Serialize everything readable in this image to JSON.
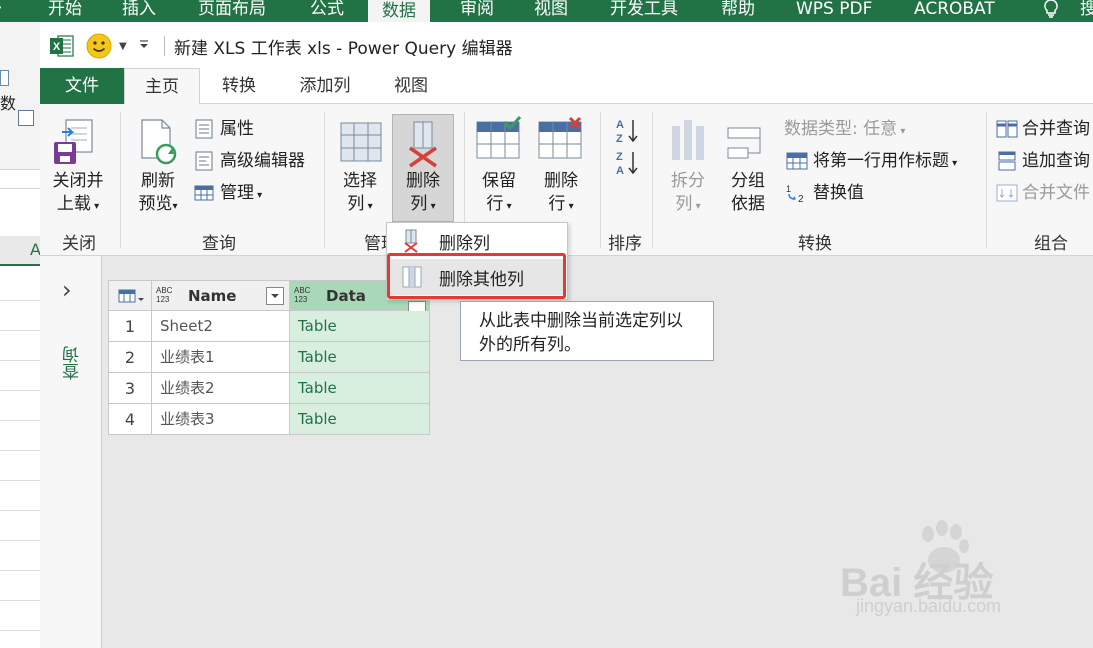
{
  "excel": {
    "tabs": [
      "开始",
      "插入",
      "页面布局",
      "公式",
      "数据",
      "审阅",
      "视图",
      "开发工具",
      "帮助",
      "WPS PDF",
      "ACROBAT",
      "搜"
    ],
    "active_tab": "数据",
    "left_fragments": [
      "数",
      "A"
    ]
  },
  "window": {
    "title": "新建 XLS 工作表 xls - Power Query 编辑器",
    "accent": "#217346"
  },
  "ribbon_tabs": [
    "文件",
    "主页",
    "转换",
    "添加列",
    "视图"
  ],
  "groups": {
    "close": {
      "label": "关闭",
      "close_load": [
        "关闭并",
        "上载"
      ]
    },
    "query": {
      "label": "查询",
      "refresh": [
        "刷新",
        "预览"
      ],
      "properties": "属性",
      "advanced_editor": "高级编辑器",
      "manage": "管理"
    },
    "manage_cols": {
      "label": "管理",
      "choose_cols": [
        "选择",
        "列"
      ],
      "remove_cols": [
        "删除",
        "列"
      ]
    },
    "reduce_rows": {
      "keep_rows": [
        "保留",
        "行"
      ],
      "remove_rows": [
        "删除",
        "行"
      ]
    },
    "sort": {
      "label": "排序"
    },
    "transform": {
      "label": "转换",
      "split_col": [
        "拆分",
        "列"
      ],
      "group_by": [
        "分组",
        "依据"
      ],
      "data_type": "数据类型: 任意",
      "use_first_row": "将第一行用作标题",
      "replace_values": "替换值"
    },
    "combine": {
      "label": "组合",
      "merge_queries": "合并查询",
      "append_queries": "追加查询",
      "combine_files": "合并文件"
    }
  },
  "dropdown": {
    "items": [
      "删除列",
      "删除其他列"
    ],
    "highlight_color": "#e53935"
  },
  "tooltip": {
    "lines": [
      "从此表中删除当前选定列以",
      "外的所有列。"
    ]
  },
  "query_pane": {
    "expand_glyph": "›",
    "label": "查询"
  },
  "table": {
    "columns": [
      {
        "type": "ABC\n123",
        "name": "Name"
      },
      {
        "type": "ABC\n123",
        "name": "Data"
      }
    ],
    "rows": [
      {
        "num": "1",
        "name": "Sheet2",
        "data": "Table"
      },
      {
        "num": "2",
        "name": "业绩表1",
        "data": "Table"
      },
      {
        "num": "3",
        "name": "业绩表2",
        "data": "Table"
      },
      {
        "num": "4",
        "name": "业绩表3",
        "data": "Table"
      }
    ]
  },
  "watermark": {
    "brand": "Bai 经验",
    "url": "jingyan.baidu.com"
  }
}
